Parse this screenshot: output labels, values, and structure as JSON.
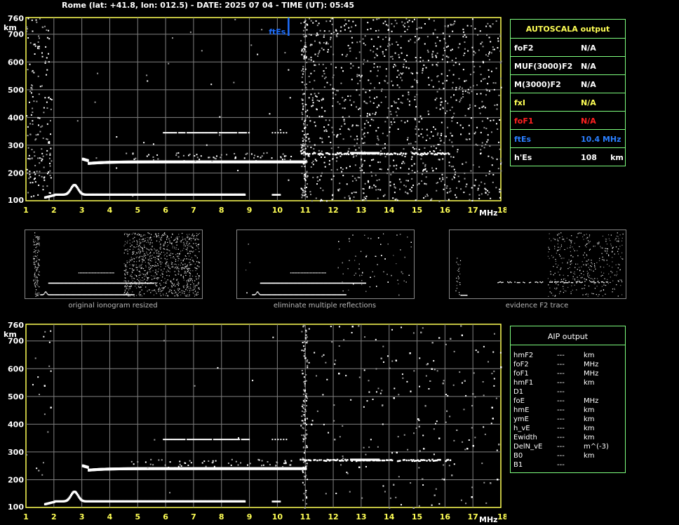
{
  "header": {
    "text": "Rome (lat: +41.8, lon: 012.5) - DATE: 2025 07 04 - TIME (UT): 05:45"
  },
  "ionogram": {
    "y_unit": "km",
    "y_ticks": [
      "100",
      "200",
      "300",
      "400",
      "500",
      "600",
      "700",
      "760"
    ],
    "x_ticks": [
      "1",
      "2",
      "3",
      "4",
      "5",
      "6",
      "7",
      "8",
      "9",
      "10",
      "11",
      "12",
      "13",
      "14",
      "15",
      "16",
      "17",
      "18"
    ],
    "x_unit": "MHz",
    "marker_label": "ftEs",
    "marker_freq": 10.4,
    "colors": {
      "axis": "#ffff55",
      "grid": "#808080",
      "trace": "#ffffff",
      "marker": "#1e6fff"
    }
  },
  "autoscala": {
    "title": "AUTOSCALA output",
    "rows": [
      {
        "label": "foF2",
        "value": "N/A",
        "color": "#ffffff"
      },
      {
        "label": "MUF(3000)F2",
        "value": "N/A",
        "color": "#ffffff"
      },
      {
        "label": "M(3000)F2",
        "value": "N/A",
        "color": "#ffffff"
      },
      {
        "label": "fxI",
        "value": "N/A",
        "color": "#ffff55"
      },
      {
        "label": "foF1",
        "value": "N/A",
        "color": "#ff2020"
      },
      {
        "label": "ftEs",
        "value": "10.4 MHz",
        "color": "#2a7fff"
      },
      {
        "label": "h'Es",
        "value": "108     km",
        "color": "#ffffff"
      }
    ]
  },
  "thumbnails": [
    {
      "caption": "original ionogram resized"
    },
    {
      "caption": "eliminate multiple reflections"
    },
    {
      "caption": "evidence F2 trace"
    }
  ],
  "aip": {
    "title": "AIP output",
    "rows": [
      {
        "label": "hmF2",
        "value": "---",
        "unit": "km"
      },
      {
        "label": "foF2",
        "value": "---",
        "unit": "MHz"
      },
      {
        "label": "foF1",
        "value": "---",
        "unit": "MHz"
      },
      {
        "label": "hmF1",
        "value": "---",
        "unit": "km"
      },
      {
        "label": "D1",
        "value": "---",
        "unit": ""
      },
      {
        "label": "foE",
        "value": "---",
        "unit": "MHz"
      },
      {
        "label": "hmE",
        "value": "---",
        "unit": "km"
      },
      {
        "label": "ymE",
        "value": "---",
        "unit": "km"
      },
      {
        "label": "h_vE",
        "value": "---",
        "unit": "km"
      },
      {
        "label": "Ewidth",
        "value": "---",
        "unit": "km"
      },
      {
        "label": "DelN_vE",
        "value": "---",
        "unit": "m^(-3)"
      },
      {
        "label": "B0",
        "value": "---",
        "unit": "km"
      },
      {
        "label": "B1",
        "value": "---",
        "unit": ""
      }
    ]
  }
}
